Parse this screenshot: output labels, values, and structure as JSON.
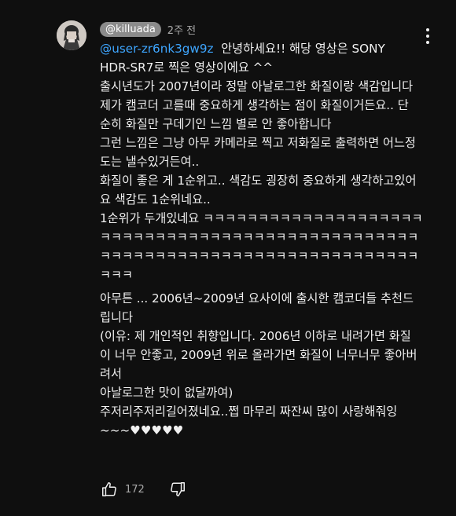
{
  "comment": {
    "author_handle": "@killuada",
    "timestamp": "2주 전",
    "mention": "@user-zr6nk3gw9z",
    "lines": [
      "안녕하세요!! 해당 영상은 SONY",
      "HDR-SR7로 찍은 영상이에요 ^^",
      "출시년도가 2007년이라 정말 아날로그한 화질이랑 색감입니다",
      "제가 캠코더 고를때 중요하게 생각하는 점이 화질이거든요.. 단",
      "순히 화질만 구데기인 느낌 별로 안 좋아합니다",
      "그런 느낌은 그냥 아무 카메라로 찍고 저화질로 출력하면 어느정",
      "도는 낼수있거든여..",
      "화질이 좋은 게 1순위고.. 색감도 굉장히 중요하게 생각하고있어",
      "요 색감도 1순위네요..",
      "1순위가 두개있네요 ㅋㅋㅋㅋㅋㅋㅋㅋㅋㅋㅋㅋㅋㅋㅋㅋㅋㅋㅋㅋ",
      "ㅋㅋㅋㅋㅋㅋㅋㅋㅋㅋㅋㅋㅋㅋㅋㅋㅋㅋㅋㅋㅋㅋㅋㅋㅋㅋㅋㅋㅋ",
      "ㅋㅋㅋㅋㅋㅋㅋㅋㅋㅋㅋㅋㅋㅋㅋㅋㅋㅋㅋㅋㅋㅋㅋㅋㅋㅋㅋㅋㅋ",
      "ㅋㅋㅋ",
      "아무튼 ... 2006년~2009년 요사이에 출시한 캠코더들 추천드",
      "립니다",
      "(이유: 제 개인적인 취향입니다. 2006년 이하로 내려가면 화질",
      "이 너무 안좋고, 2009년 위로 올라가면 화질이 너무너무 좋아버",
      "려서",
      "아날로그한 맛이 없달까여)",
      "주저리주저리길어졌네요..쩝 마무리 짜잔씨 많이 사랑해줘잉",
      "~~~♥♥♥♥♥"
    ],
    "like_count": "172"
  },
  "icons": {
    "avatar": "avatar",
    "menu": "more-vert-icon",
    "like": "thumbs-up-icon",
    "dislike": "thumbs-down-icon"
  },
  "colors": {
    "background": "#0f0f0f",
    "mention": "#3ea6ff",
    "chip": "#8b8b8b",
    "text": "#f1f1f1",
    "muted": "#aaaaaa"
  }
}
